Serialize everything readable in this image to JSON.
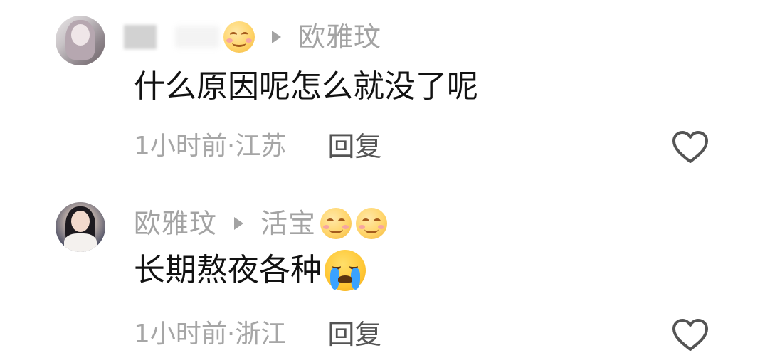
{
  "comments": [
    {
      "username": "",
      "reply_to": "欧雅玟",
      "text": "什么原因呢怎么就没了呢",
      "meta": "1小时前·江苏",
      "reply_label": "回复",
      "emojis": [
        "smile-emoji"
      ]
    },
    {
      "username": "欧雅玟",
      "reply_to": "活宝",
      "text": "长期熬夜各种",
      "meta": "1小时前·浙江",
      "reply_label": "回复",
      "emojis": [
        "smile-emoji",
        "smile-emoji",
        "crying-emoji"
      ]
    }
  ],
  "icons": {
    "reply_arrow": "triangle-right-icon",
    "like": "heart-outline-icon"
  },
  "colors": {
    "background": "#ffffff",
    "username": "#a3a3a3",
    "content": "#121212",
    "meta": "#a6a6a6",
    "reply": "#545454",
    "heart_stroke": "#545454"
  }
}
